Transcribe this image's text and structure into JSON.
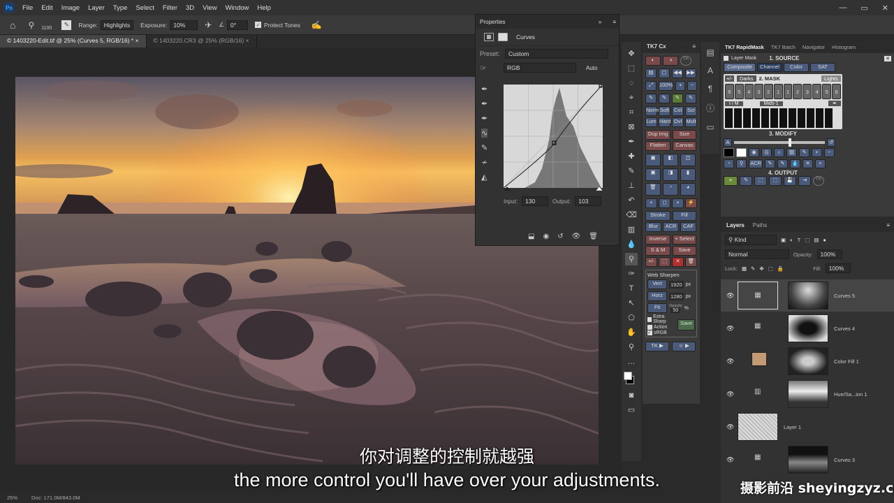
{
  "menu": [
    "File",
    "Edit",
    "Image",
    "Layer",
    "Type",
    "Select",
    "Filter",
    "3D",
    "View",
    "Window",
    "Help"
  ],
  "options": {
    "brush_size": "1100",
    "range_label": "Range:",
    "range_value": "Highlights",
    "exposure_label": "Exposure:",
    "exposure_value": "10%",
    "angle_value": "0°",
    "protect_tones": "Protect Tones"
  },
  "tabs": [
    "© 1403220-Edit.tif @ 25% (Curves 5, RGB/16) *",
    "© 1403220.CR3 @ 25% (RGB/16)"
  ],
  "properties": {
    "title": "Properties",
    "adjustment": "Curves",
    "preset_label": "Preset:",
    "preset_value": "Custom",
    "channel": "RGB",
    "auto": "Auto",
    "input_label": "Input:",
    "input_value": "130",
    "output_label": "Output:",
    "output_value": "103"
  },
  "tk7cx": {
    "title": "TK7 Cx",
    "pct": "100%",
    "row1": [
      "Norm",
      "Soft",
      "Col",
      "Scr"
    ],
    "row2": [
      "Lum",
      "Hard",
      "Ovl",
      "Mult"
    ],
    "row3": [
      "Dup Img",
      "Size"
    ],
    "row4": [
      "Flatten",
      "Canvas"
    ],
    "row5": [
      "Stroke",
      "Fill"
    ],
    "row6": [
      "Blur",
      "ACR",
      "CAF"
    ],
    "row7": [
      "Inverse",
      "+ Select"
    ],
    "row8": [
      "S & M",
      "Save"
    ],
    "websharpen": "Web Sharpen",
    "vert": "Vert",
    "vert_val": "1920",
    "horz": "Horz",
    "horz_val": "1280",
    "px": "px",
    "fit": "Fit",
    "opacity_label": "Opacity",
    "opacity_val": "50",
    "pct_sign": "%",
    "extra_sharp": "Extra Sharp",
    "action": "Action",
    "srgb": "sRGB",
    "save": "Save",
    "tk": "TK ▶"
  },
  "rapid": {
    "tabs": [
      "TK7 RapidMask",
      "TK7 Batch",
      "Navigator",
      "Histogram"
    ],
    "layer_mask": "Layer Mask",
    "source": "1. SOURCE",
    "src_tabs": [
      "Composite",
      "Channel",
      "Color",
      "SAT"
    ],
    "mask": "2. MASK",
    "darks": "Darks",
    "lights": "Lights",
    "mids": "Mids-1",
    "im": "I / M",
    "modify": "3. MODIFY",
    "acr": "ACR",
    "output": "4. OUTPUT",
    "nums": [
      "6",
      "5",
      "4",
      "3",
      "2",
      "1",
      "1",
      "2",
      "3",
      "4",
      "5",
      "6"
    ]
  },
  "layers": {
    "tabs": [
      "Layers",
      "Paths"
    ],
    "kind": "Kind",
    "blend": "Normal",
    "opacity_label": "Opacity:",
    "opacity": "100%",
    "lock_label": "Lock:",
    "fill_label": "Fill:",
    "fill": "100%",
    "items": [
      "Curves 5",
      "Curves 4",
      "Color Fill 1",
      "Hue/Sa...ion 1",
      "Layer 1",
      "Curves 3"
    ]
  },
  "status": {
    "zoom": "25%",
    "doc": "Doc: 171.0M/843.0M"
  },
  "subtitles": {
    "zh": "你对调整的控制就越强",
    "en": "the more control you'll have over your adjustments."
  },
  "watermark": "摄影前沿 sheyingzyz.com"
}
